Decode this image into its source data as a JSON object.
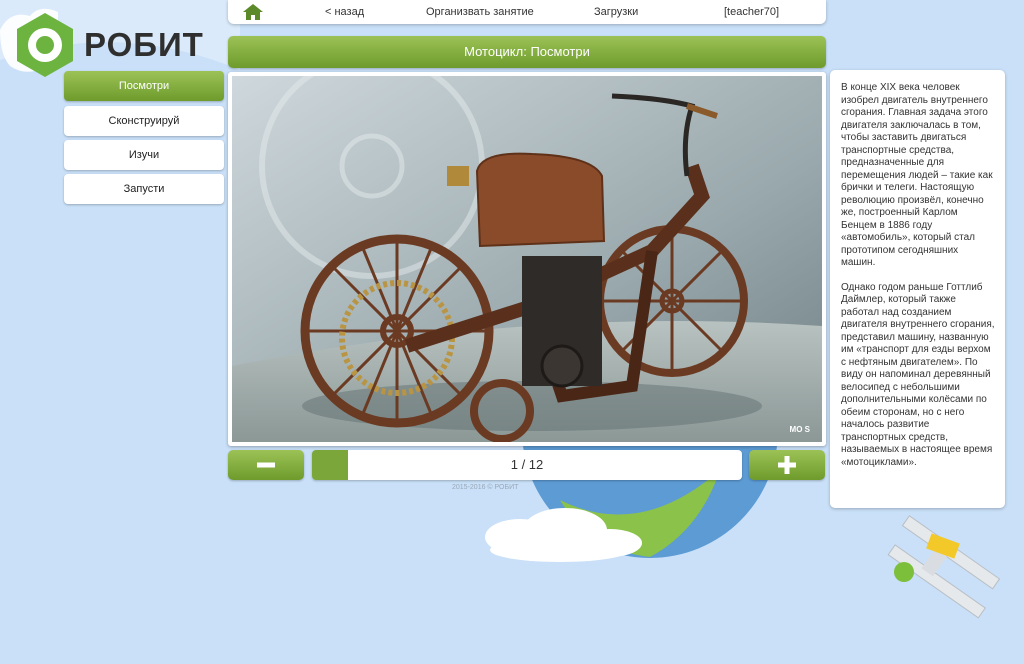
{
  "brand": {
    "name": "РОБИТ"
  },
  "nav": {
    "back": "< назад",
    "organize": "Организвать занятие",
    "downloads": "Загрузки",
    "user": "[teacher70]"
  },
  "sidebar": {
    "items": [
      {
        "label": "Посмотри",
        "active": true
      },
      {
        "label": "Сконструируй",
        "active": false
      },
      {
        "label": "Изучи",
        "active": false
      },
      {
        "label": "Запусти",
        "active": false
      }
    ]
  },
  "main": {
    "title": "Мотоцикл: Посмотри",
    "image_watermark": "MO S"
  },
  "pager": {
    "label": "1 / 12",
    "current": 1,
    "total": 12
  },
  "footer": {
    "text": "2015-2016 © РОБИТ"
  },
  "description": {
    "paragraph_1": "В конце XIX века человек изобрел двигатель внутреннего сгорания. Главная задача этого двигателя заключалась в том, чтобы заставить двигаться транспортные средства, предназначенные для перемещения людей – такие как брички и телеги. Настоящую революцию произвёл, конечно же, построенный Карлом Бенцем в 1886 году «автомобиль», который стал прототипом сегодняшних машин.",
    "paragraph_2": "Однако годом раньше Готтлиб Даймлер, который также работал над созданием двигателя внутреннего сгорания, представил машину, названную им «транспорт для езды верхом с нефтяным двигателем». По виду он напоминал деревянный велосипед с небольшими дополнительными колёсами по обеим сторонам, но с него началось развитие транспортных средств, называемых в настоящее время «мотоциклами»."
  },
  "colors": {
    "accent_green": "#7aa63a",
    "background": "#c9e0f8",
    "logo_green": "#6db33f"
  },
  "icons": {
    "home": "home-icon",
    "minus": "minus-icon",
    "plus": "plus-icon"
  }
}
